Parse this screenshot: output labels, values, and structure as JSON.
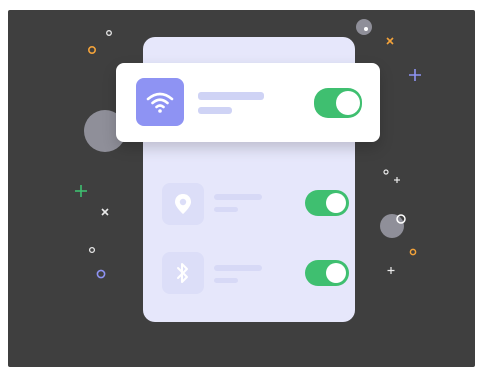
{
  "colors": {
    "backdrop": "#3f3f3f",
    "phone_bg": "#e6e7fb",
    "card_bg": "#ffffff",
    "primary_icon_bg": "#8e93f3",
    "muted_icon_bg": "#dcdef8",
    "placeholder_bar": "#cfd3f5",
    "muted_bar": "#d7d9f6",
    "toggle_on": "#3fbf70",
    "glyph_muted": "#ffffff"
  },
  "settings": [
    {
      "id": "wifi",
      "icon": "wifi-icon",
      "enabled": true,
      "highlighted": true
    },
    {
      "id": "location",
      "icon": "location-pin-icon",
      "enabled": true,
      "highlighted": false
    },
    {
      "id": "bluetooth",
      "icon": "bluetooth-icon",
      "enabled": true,
      "highlighted": false
    }
  ]
}
